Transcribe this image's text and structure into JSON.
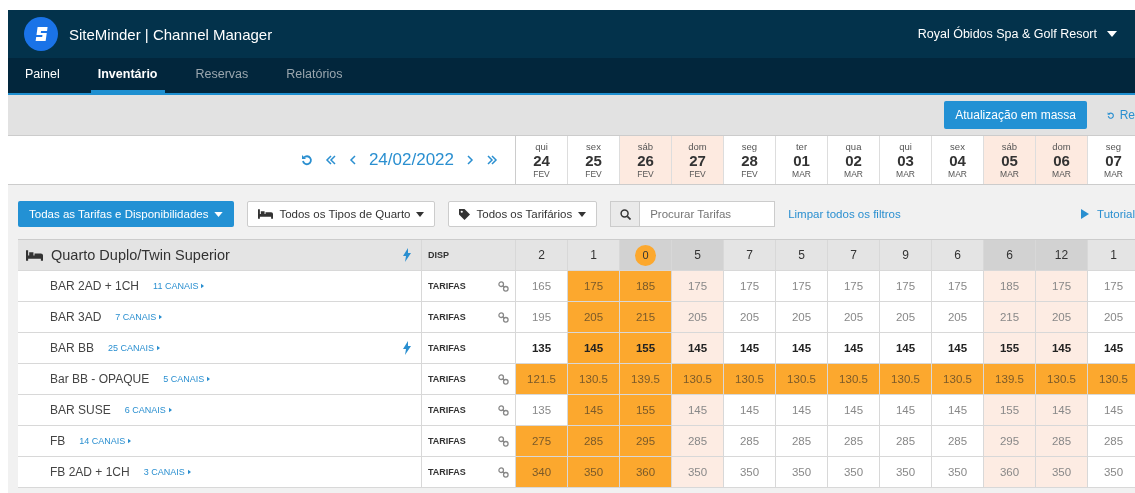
{
  "header": {
    "brand": "SiteMinder | Channel Manager",
    "property": "Royal Óbidos Spa & Golf Resort"
  },
  "tabs": [
    {
      "label": "Painel",
      "selected": false,
      "dimmed": false
    },
    {
      "label": "Inventário",
      "selected": true,
      "dimmed": false
    },
    {
      "label": "Reservas",
      "selected": false,
      "dimmed": true
    },
    {
      "label": "Relatórios",
      "selected": false,
      "dimmed": true
    }
  ],
  "toolbar": {
    "bulk_button": "Atualização em massa",
    "refresh_link": "Re"
  },
  "date_nav": {
    "date": "24/02/2022"
  },
  "days": [
    {
      "weekday": "qui",
      "day": "24",
      "month": "FEV",
      "weekend": false
    },
    {
      "weekday": "sex",
      "day": "25",
      "month": "FEV",
      "weekend": false
    },
    {
      "weekday": "sáb",
      "day": "26",
      "month": "FEV",
      "weekend": true
    },
    {
      "weekday": "dom",
      "day": "27",
      "month": "FEV",
      "weekend": true
    },
    {
      "weekday": "seg",
      "day": "28",
      "month": "FEV",
      "weekend": false
    },
    {
      "weekday": "ter",
      "day": "01",
      "month": "MAR",
      "weekend": false
    },
    {
      "weekday": "qua",
      "day": "02",
      "month": "MAR",
      "weekend": false
    },
    {
      "weekday": "qui",
      "day": "03",
      "month": "MAR",
      "weekend": false
    },
    {
      "weekday": "sex",
      "day": "04",
      "month": "MAR",
      "weekend": false
    },
    {
      "weekday": "sáb",
      "day": "05",
      "month": "MAR",
      "weekend": true
    },
    {
      "weekday": "dom",
      "day": "06",
      "month": "MAR",
      "weekend": true
    },
    {
      "weekday": "seg",
      "day": "07",
      "month": "MAR",
      "weekend": false
    }
  ],
  "filters": {
    "main_button": "Todas as Tarifas e Disponibilidades",
    "room_types": "Todos os Tipos de Quarto",
    "rate_plans": "Todos os Tarifários",
    "search_placeholder": "Procurar Tarifas",
    "clear_link": "Limpar todos os filtros",
    "tutorial_link": "Tutorial"
  },
  "room": {
    "name": "Quarto Duplo/Twin Superior",
    "lightning": true,
    "availability_label": "DISP",
    "availability": [
      {
        "value": "2",
        "alert": false
      },
      {
        "value": "1",
        "alert": false
      },
      {
        "value": "0",
        "alert": true
      },
      {
        "value": "5",
        "alert": false
      },
      {
        "value": "7",
        "alert": false
      },
      {
        "value": "5",
        "alert": false
      },
      {
        "value": "7",
        "alert": false
      },
      {
        "value": "9",
        "alert": false
      },
      {
        "value": "6",
        "alert": false
      },
      {
        "value": "6",
        "alert": false
      },
      {
        "value": "12",
        "alert": false
      },
      {
        "value": "1",
        "alert": false
      }
    ]
  },
  "rates": [
    {
      "name": "BAR 2AD + 1CH",
      "channels": "11 CANAIS",
      "label": "TARIFAS",
      "kind": "linked",
      "cells": [
        {
          "value": "165",
          "highlighted": false
        },
        {
          "value": "175",
          "highlighted": true
        },
        {
          "value": "185",
          "highlighted": true
        },
        {
          "value": "175",
          "highlighted": false
        },
        {
          "value": "175",
          "highlighted": false
        },
        {
          "value": "175",
          "highlighted": false
        },
        {
          "value": "175",
          "highlighted": false
        },
        {
          "value": "175",
          "highlighted": false
        },
        {
          "value": "175",
          "highlighted": false
        },
        {
          "value": "185",
          "highlighted": false
        },
        {
          "value": "175",
          "highlighted": false
        },
        {
          "value": "175",
          "highlighted": false
        }
      ]
    },
    {
      "name": "BAR 3AD",
      "channels": "7 CANAIS",
      "label": "TARIFAS",
      "kind": "linked",
      "cells": [
        {
          "value": "195",
          "highlighted": false
        },
        {
          "value": "205",
          "highlighted": true
        },
        {
          "value": "215",
          "highlighted": true
        },
        {
          "value": "205",
          "highlighted": false
        },
        {
          "value": "205",
          "highlighted": false
        },
        {
          "value": "205",
          "highlighted": false
        },
        {
          "value": "205",
          "highlighted": false
        },
        {
          "value": "205",
          "highlighted": false
        },
        {
          "value": "205",
          "highlighted": false
        },
        {
          "value": "215",
          "highlighted": false
        },
        {
          "value": "205",
          "highlighted": false
        },
        {
          "value": "205",
          "highlighted": false
        }
      ]
    },
    {
      "name": "BAR BB",
      "channels": "25 CANAIS",
      "label": "TARIFAS",
      "kind": "master",
      "cells": [
        {
          "value": "135",
          "highlighted": false
        },
        {
          "value": "145",
          "highlighted": true
        },
        {
          "value": "155",
          "highlighted": true
        },
        {
          "value": "145",
          "highlighted": false
        },
        {
          "value": "145",
          "highlighted": false
        },
        {
          "value": "145",
          "highlighted": false
        },
        {
          "value": "145",
          "highlighted": false
        },
        {
          "value": "145",
          "highlighted": false
        },
        {
          "value": "145",
          "highlighted": false
        },
        {
          "value": "155",
          "highlighted": false
        },
        {
          "value": "145",
          "highlighted": false
        },
        {
          "value": "145",
          "highlighted": false
        }
      ]
    },
    {
      "name": "Bar BB - OPAQUE",
      "channels": "5 CANAIS",
      "label": "TARIFAS",
      "kind": "linked",
      "cells": [
        {
          "value": "121.5",
          "highlighted": true
        },
        {
          "value": "130.5",
          "highlighted": true
        },
        {
          "value": "139.5",
          "highlighted": true
        },
        {
          "value": "130.5",
          "highlighted": true
        },
        {
          "value": "130.5",
          "highlighted": true
        },
        {
          "value": "130.5",
          "highlighted": true
        },
        {
          "value": "130.5",
          "highlighted": true
        },
        {
          "value": "130.5",
          "highlighted": true
        },
        {
          "value": "130.5",
          "highlighted": true
        },
        {
          "value": "139.5",
          "highlighted": true
        },
        {
          "value": "130.5",
          "highlighted": true
        },
        {
          "value": "130.5",
          "highlighted": true
        }
      ]
    },
    {
      "name": "BAR SUSE",
      "channels": "6 CANAIS",
      "label": "TARIFAS",
      "kind": "linked",
      "cells": [
        {
          "value": "135",
          "highlighted": false
        },
        {
          "value": "145",
          "highlighted": true
        },
        {
          "value": "155",
          "highlighted": true
        },
        {
          "value": "145",
          "highlighted": false
        },
        {
          "value": "145",
          "highlighted": false
        },
        {
          "value": "145",
          "highlighted": false
        },
        {
          "value": "145",
          "highlighted": false
        },
        {
          "value": "145",
          "highlighted": false
        },
        {
          "value": "145",
          "highlighted": false
        },
        {
          "value": "155",
          "highlighted": false
        },
        {
          "value": "145",
          "highlighted": false
        },
        {
          "value": "145",
          "highlighted": false
        }
      ]
    },
    {
      "name": "FB",
      "channels": "14 CANAIS",
      "label": "TARIFAS",
      "kind": "linked",
      "cells": [
        {
          "value": "275",
          "highlighted": true
        },
        {
          "value": "285",
          "highlighted": true
        },
        {
          "value": "295",
          "highlighted": true
        },
        {
          "value": "285",
          "highlighted": false
        },
        {
          "value": "285",
          "highlighted": false
        },
        {
          "value": "285",
          "highlighted": false
        },
        {
          "value": "285",
          "highlighted": false
        },
        {
          "value": "285",
          "highlighted": false
        },
        {
          "value": "285",
          "highlighted": false
        },
        {
          "value": "295",
          "highlighted": false
        },
        {
          "value": "285",
          "highlighted": false
        },
        {
          "value": "285",
          "highlighted": false
        }
      ]
    },
    {
      "name": "FB 2AD + 1CH",
      "channels": "3 CANAIS",
      "label": "TARIFAS",
      "kind": "linked",
      "cells": [
        {
          "value": "340",
          "highlighted": true
        },
        {
          "value": "350",
          "highlighted": true
        },
        {
          "value": "360",
          "highlighted": true
        },
        {
          "value": "350",
          "highlighted": false
        },
        {
          "value": "350",
          "highlighted": false
        },
        {
          "value": "350",
          "highlighted": false
        },
        {
          "value": "350",
          "highlighted": false
        },
        {
          "value": "350",
          "highlighted": false
        },
        {
          "value": "350",
          "highlighted": false
        },
        {
          "value": "360",
          "highlighted": false
        },
        {
          "value": "350",
          "highlighted": false
        },
        {
          "value": "350",
          "highlighted": false
        }
      ]
    }
  ]
}
